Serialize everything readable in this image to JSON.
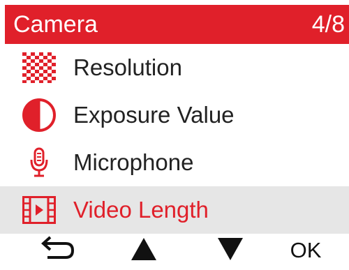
{
  "header": {
    "title": "Camera",
    "page": "4/8"
  },
  "menu": {
    "items": [
      {
        "label": "Resolution",
        "icon": "checkerboard-icon"
      },
      {
        "label": "Exposure Value",
        "icon": "half-circle-icon"
      },
      {
        "label": "Microphone",
        "icon": "microphone-icon"
      },
      {
        "label": "Video Length",
        "icon": "film-strip-icon",
        "selected": true
      }
    ]
  },
  "footer": {
    "back_icon": "return-arrow-icon",
    "up_icon": "triangle-up-icon",
    "down_icon": "triangle-down-icon",
    "ok_label": "OK"
  },
  "colors": {
    "accent": "#e0202a",
    "selected_bg": "#e6e6e6",
    "text": "#222222"
  }
}
